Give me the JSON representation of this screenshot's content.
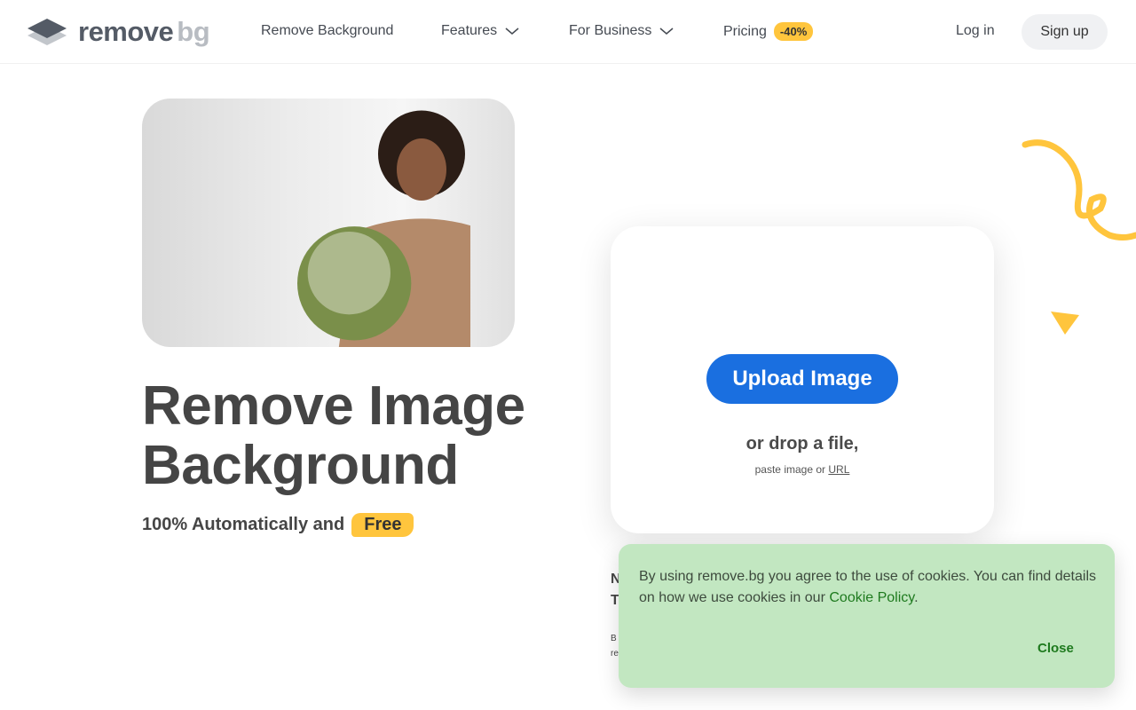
{
  "nav": {
    "logo_main": "remove",
    "logo_accent": "bg",
    "items": [
      {
        "label": "Remove Background"
      },
      {
        "label": "Features"
      },
      {
        "label": "For Business"
      },
      {
        "label": "Pricing"
      }
    ],
    "pricing_badge": "-40%",
    "login": "Log in",
    "signup": "Sign up"
  },
  "hero": {
    "title_line1": "Remove Image",
    "title_line2": "Background",
    "subtitle": "100% Automatically and",
    "free": "Free"
  },
  "upload": {
    "button": "Upload Image",
    "drop": "or drop a file,",
    "paste_prefix": "paste image or",
    "url": "URL"
  },
  "hidden_fragments": [
    "N",
    "T",
    "B",
    "re"
  ],
  "cookie": {
    "text": "By using remove.bg you agree to the use of cookies. You can find details on how we use cookies in our",
    "link": "Cookie Policy",
    "period": ".",
    "close": "Close"
  },
  "colors": {
    "accent": "#1a6fe0",
    "yellow": "#ffc53d",
    "cookie_bg": "#c2e7c1",
    "cookie_link": "#1e7a1e"
  }
}
